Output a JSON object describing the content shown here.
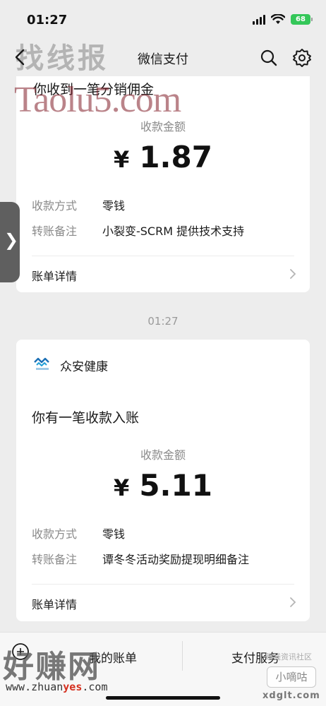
{
  "status_bar": {
    "time": "01:27",
    "battery": "68"
  },
  "nav": {
    "title": "微信支付"
  },
  "watermarks": {
    "top": "找线报",
    "taolu": "Taolu5.com",
    "bottom_left": "好赚网",
    "bottom_left_url_prefix": "www.zhuan",
    "bottom_left_url_highlight": "yes",
    "bottom_left_url_suffix": ".com",
    "bottom_right_badge": "小嘀咕",
    "bottom_right_caption": "赚钱资讯社区",
    "bottom_right_url": "xdglt.com"
  },
  "message1": {
    "title": "你收到一笔分销佣金",
    "amount_label": "收款金额",
    "currency": "¥",
    "amount": "1.87",
    "rows": [
      {
        "label": "收款方式",
        "value": "零钱"
      },
      {
        "label": "转账备注",
        "value": "小裂变-SCRM 提供技术支持"
      }
    ],
    "bill_link": "账单详情"
  },
  "timestamp": "01:27",
  "message2": {
    "brand": "众安健康",
    "title": "你有一笔收款入账",
    "amount_label": "收款金额",
    "currency": "¥",
    "amount": "5.11",
    "rows": [
      {
        "label": "收款方式",
        "value": "零钱"
      },
      {
        "label": "转账备注",
        "value": "谭冬冬活动奖励提现明细备注"
      }
    ],
    "bill_link": "账单详情"
  },
  "bottom_bar": {
    "my_bill": "我的账单",
    "pay_service": "支付服务"
  },
  "side_handle": {
    "glyph": "❯"
  },
  "colors": {
    "background": "#ededed",
    "card": "#ffffff",
    "brand": "#1a6fb5"
  }
}
